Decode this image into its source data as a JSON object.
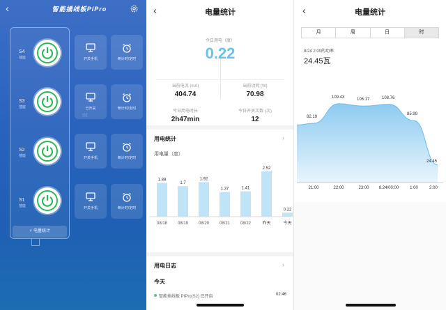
{
  "panel1": {
    "title": "智能插线板PIPro",
    "sockets": [
      {
        "id": "S4",
        "sub": "插座"
      },
      {
        "id": "S3",
        "sub": "插座"
      },
      {
        "id": "S2",
        "sub": "插座"
      },
      {
        "id": "S1",
        "sub": "插座"
      }
    ],
    "tiles": [
      {
        "a": "开关手机",
        "b": "倒计时/定时"
      },
      {
        "a": "已开关",
        "b": "倒计时/定时"
      },
      {
        "a": "开关手机",
        "b": "倒计时/定时"
      },
      {
        "a": "开关手机",
        "b": "倒计时/定时"
      }
    ],
    "summary_button": "电量统计",
    "accent": "#2fb85a",
    "watermark": "nt"
  },
  "panel2": {
    "title": "电量统计",
    "today_label": "今日用电（度）",
    "today_value": "0.22",
    "stats": [
      {
        "label": "当前电流 (mA)",
        "value": "404.74"
      },
      {
        "label": "当前功耗 (W)",
        "value": "70.98"
      },
      {
        "label": "今日用电时长",
        "value": "2h47min"
      },
      {
        "label": "今日开关次数 (次)",
        "value": "12"
      }
    ],
    "usage_section": "用电统计",
    "log_section": "用电日志",
    "today_heading": "今天",
    "log_entry": "智能插线板 PIPro(S2) 已开启",
    "log_time": "02:46",
    "accent": "#66c3ee"
  },
  "chart_data": [
    {
      "type": "bar",
      "title": "",
      "ylabel": "用电量（度）",
      "categories": [
        "08/18",
        "08/19",
        "08/20",
        "08/21",
        "08/22",
        "昨天",
        "今天"
      ],
      "values": [
        1.88,
        1.7,
        1.92,
        1.37,
        1.41,
        2.52,
        0.22
      ],
      "data_labels": [
        "1.88",
        "1.7",
        "1.92",
        "1.37",
        "1.41",
        "2.52",
        "0.22"
      ],
      "ylim": [
        0,
        2.52
      ],
      "grid": false,
      "color": "#bfe3f7"
    },
    {
      "type": "area",
      "title": "",
      "categories": [
        "21:00",
        "22:00",
        "23:00",
        "8.24/00:00",
        "1:00",
        "2:00"
      ],
      "x": [
        "20:30",
        "21:00",
        "22:00",
        "23:00",
        "8.24/00:00",
        "1:00",
        "2:00"
      ],
      "values": [
        80,
        82.19,
        109.43,
        106.17,
        108.76,
        85.99,
        24.45
      ],
      "labeled_points": [
        "82.19",
        "109.43",
        "106.17",
        "108.76",
        "85.99",
        "24.45"
      ],
      "ylim": [
        0,
        120
      ],
      "grid": false,
      "color": "#9fd3f3",
      "tabs": [
        "月",
        "周",
        "日",
        "时"
      ],
      "active_tab": "时",
      "point_time": "8/24 2:00的功率:",
      "point_value": "24.45瓦"
    }
  ]
}
